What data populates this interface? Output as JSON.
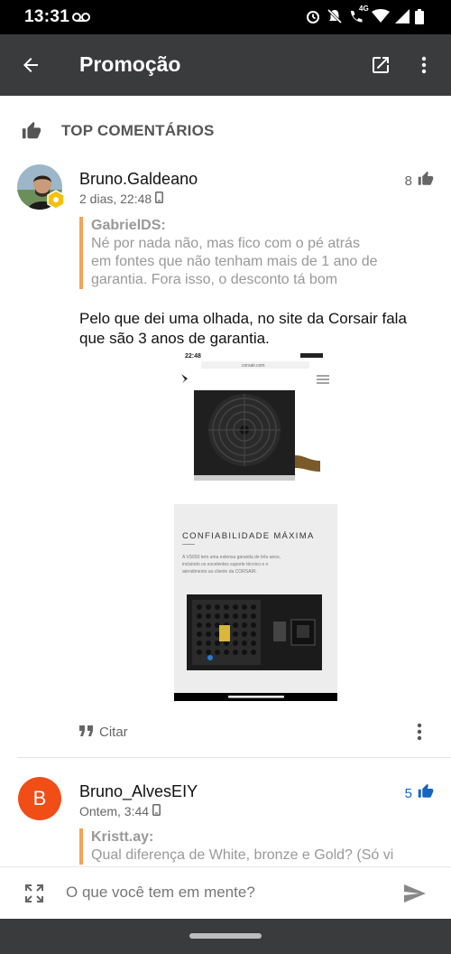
{
  "status_bar": {
    "time": "13:31",
    "network": "4G"
  },
  "app_bar": {
    "title": "Promoção"
  },
  "section": {
    "label": "TOP COMENTÁRIOS"
  },
  "comments": [
    {
      "author": "Bruno.Galdeano",
      "meta": "2 dias, 22:48",
      "votes": "8",
      "quote": {
        "author": "GabrielDS:",
        "lines": [
          "Né por nada não, mas fico com o pé atrás",
          "em fontes que não tenham mais de 1 ano de",
          "garantia. Fora isso, o desconto tá bom"
        ]
      },
      "body": [
        "Pelo que dei uma olhada, no site da Corsair fala",
        "que são 3 anos de garantia."
      ],
      "attachment1": {
        "time": "22:48",
        "url": "corsair.com"
      },
      "attachment2": {
        "heading": "CONFIABILIDADE MÁXIMA",
        "lines": [
          "A VS650 tem uma extensa garantia de três anos,",
          "incluindo os excelentes suporte técnico e o",
          "atendimento ao cliente da CORSAIR."
        ]
      },
      "cite_label": "Citar"
    },
    {
      "author": "Bruno_AlvesEIY",
      "avatar_letter": "B",
      "meta": "Ontem, 3:44",
      "votes": "5",
      "quote": {
        "author": "Kristt.ay:",
        "lines": [
          "Qual diferença de White, bronze e Gold? (Só vi"
        ]
      }
    }
  ],
  "composer": {
    "placeholder": "O que você tem em mente?"
  },
  "colors": {
    "app_bar": "#3a3b3d",
    "quote_border": "#f5a15a",
    "avatar_b": "#f04d17",
    "vote_blue": "#1565c0"
  }
}
